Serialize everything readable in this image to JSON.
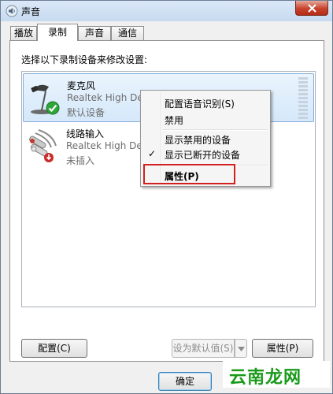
{
  "window": {
    "title": "声音"
  },
  "tabs": [
    {
      "label": "播放"
    },
    {
      "label": "录制"
    },
    {
      "label": "声音"
    },
    {
      "label": "通信"
    }
  ],
  "panel": {
    "instruction": "选择以下录制设备来修改设置:"
  },
  "devices": [
    {
      "name": "麦克风",
      "driver": "Realtek High Definition Audio",
      "status": "默认设备"
    },
    {
      "name": "线路输入",
      "driver": "Realtek High Definition Audio",
      "status": "未插入"
    }
  ],
  "context_menu": {
    "items": [
      {
        "label": "配置语音识别(S)"
      },
      {
        "label": "禁用"
      },
      {
        "label": "显示禁用的设备"
      },
      {
        "label": "显示已断开的设备",
        "checked": "✓"
      },
      {
        "label": "属性(P)"
      }
    ]
  },
  "buttons": {
    "configure": "配置(C)",
    "set_default": "设为默认值(S)",
    "properties": "属性(P)",
    "ok": "确定"
  },
  "watermark": "云南龙网",
  "colors": {
    "highlight_box": "#d21f1f",
    "selection": "#d5e8fa",
    "watermark": "#1a9a1a"
  }
}
